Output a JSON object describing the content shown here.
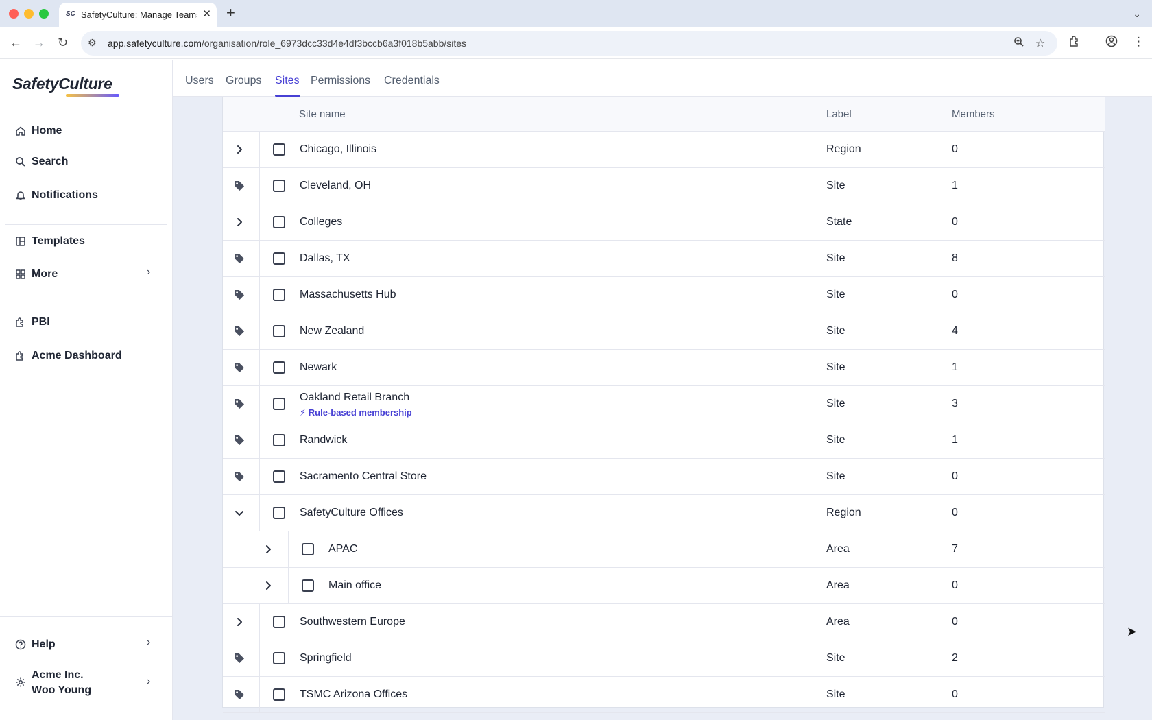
{
  "browser": {
    "tab_title": "SafetyCulture: Manage Teams",
    "tab_favicon": "SC",
    "url_host": "app.safetyculture.com",
    "url_path": "/organisation/role_6973dcc33d4e4df3bccb6a3f018b5abb/sites"
  },
  "sidebar": {
    "logo": "SafetyCulture",
    "items": [
      {
        "label": "Home",
        "icon": "home-icon"
      },
      {
        "label": "Search",
        "icon": "search-icon"
      },
      {
        "label": "Notifications",
        "icon": "bell-icon"
      },
      {
        "label": "Templates",
        "icon": "templates-icon"
      },
      {
        "label": "More",
        "icon": "grid-icon"
      },
      {
        "label": "PBI",
        "icon": "puzzle-icon"
      },
      {
        "label": "Acme Dashboard",
        "icon": "puzzle-icon"
      }
    ],
    "help_label": "Help",
    "org_name": "Acme Inc.",
    "user_name": "Woo Young"
  },
  "topnav": {
    "tabs": [
      "Users",
      "Groups",
      "Sites",
      "Permissions",
      "Credentials"
    ],
    "active": "Sites"
  },
  "table": {
    "columns": {
      "site": "Site name",
      "label": "Label",
      "members": "Members"
    },
    "rows": [
      {
        "name": "Chicago, Illinois",
        "label": "Region",
        "members": "0",
        "icon": "chevron-right-icon",
        "level": 0
      },
      {
        "name": "Cleveland, OH",
        "label": "Site",
        "members": "1",
        "icon": "tag-icon",
        "level": 0
      },
      {
        "name": "Colleges",
        "label": "State",
        "members": "0",
        "icon": "chevron-right-icon",
        "level": 0
      },
      {
        "name": "Dallas, TX",
        "label": "Site",
        "members": "8",
        "icon": "tag-icon",
        "level": 0
      },
      {
        "name": "Massachusetts Hub",
        "label": "Site",
        "members": "0",
        "icon": "tag-icon",
        "level": 0
      },
      {
        "name": "New Zealand",
        "label": "Site",
        "members": "4",
        "icon": "tag-icon",
        "level": 0
      },
      {
        "name": "Newark",
        "label": "Site",
        "members": "1",
        "icon": "tag-icon",
        "level": 0
      },
      {
        "name": "Oakland Retail Branch",
        "sub": "Rule-based membership",
        "label": "Site",
        "members": "3",
        "icon": "tag-icon",
        "level": 0
      },
      {
        "name": "Randwick",
        "label": "Site",
        "members": "1",
        "icon": "tag-icon",
        "level": 0
      },
      {
        "name": "Sacramento Central Store",
        "label": "Site",
        "members": "0",
        "icon": "tag-icon",
        "level": 0
      },
      {
        "name": "SafetyCulture Offices",
        "label": "Region",
        "members": "0",
        "icon": "chevron-down-icon",
        "level": 0
      },
      {
        "name": "APAC",
        "label": "Area",
        "members": "7",
        "icon": "chevron-right-icon",
        "level": 1
      },
      {
        "name": "Main office",
        "label": "Area",
        "members": "0",
        "icon": "chevron-right-icon",
        "level": 1
      },
      {
        "name": "Southwestern Europe",
        "label": "Area",
        "members": "0",
        "icon": "chevron-right-icon",
        "level": 0
      },
      {
        "name": "Springfield",
        "label": "Site",
        "members": "2",
        "icon": "tag-icon",
        "level": 0
      },
      {
        "name": "TSMC Arizona Offices",
        "label": "Site",
        "members": "0",
        "icon": "tag-icon",
        "level": 0
      }
    ]
  },
  "colors": {
    "accent": "#4740d4",
    "background": "#e9edf6",
    "text": "#1f2533"
  }
}
